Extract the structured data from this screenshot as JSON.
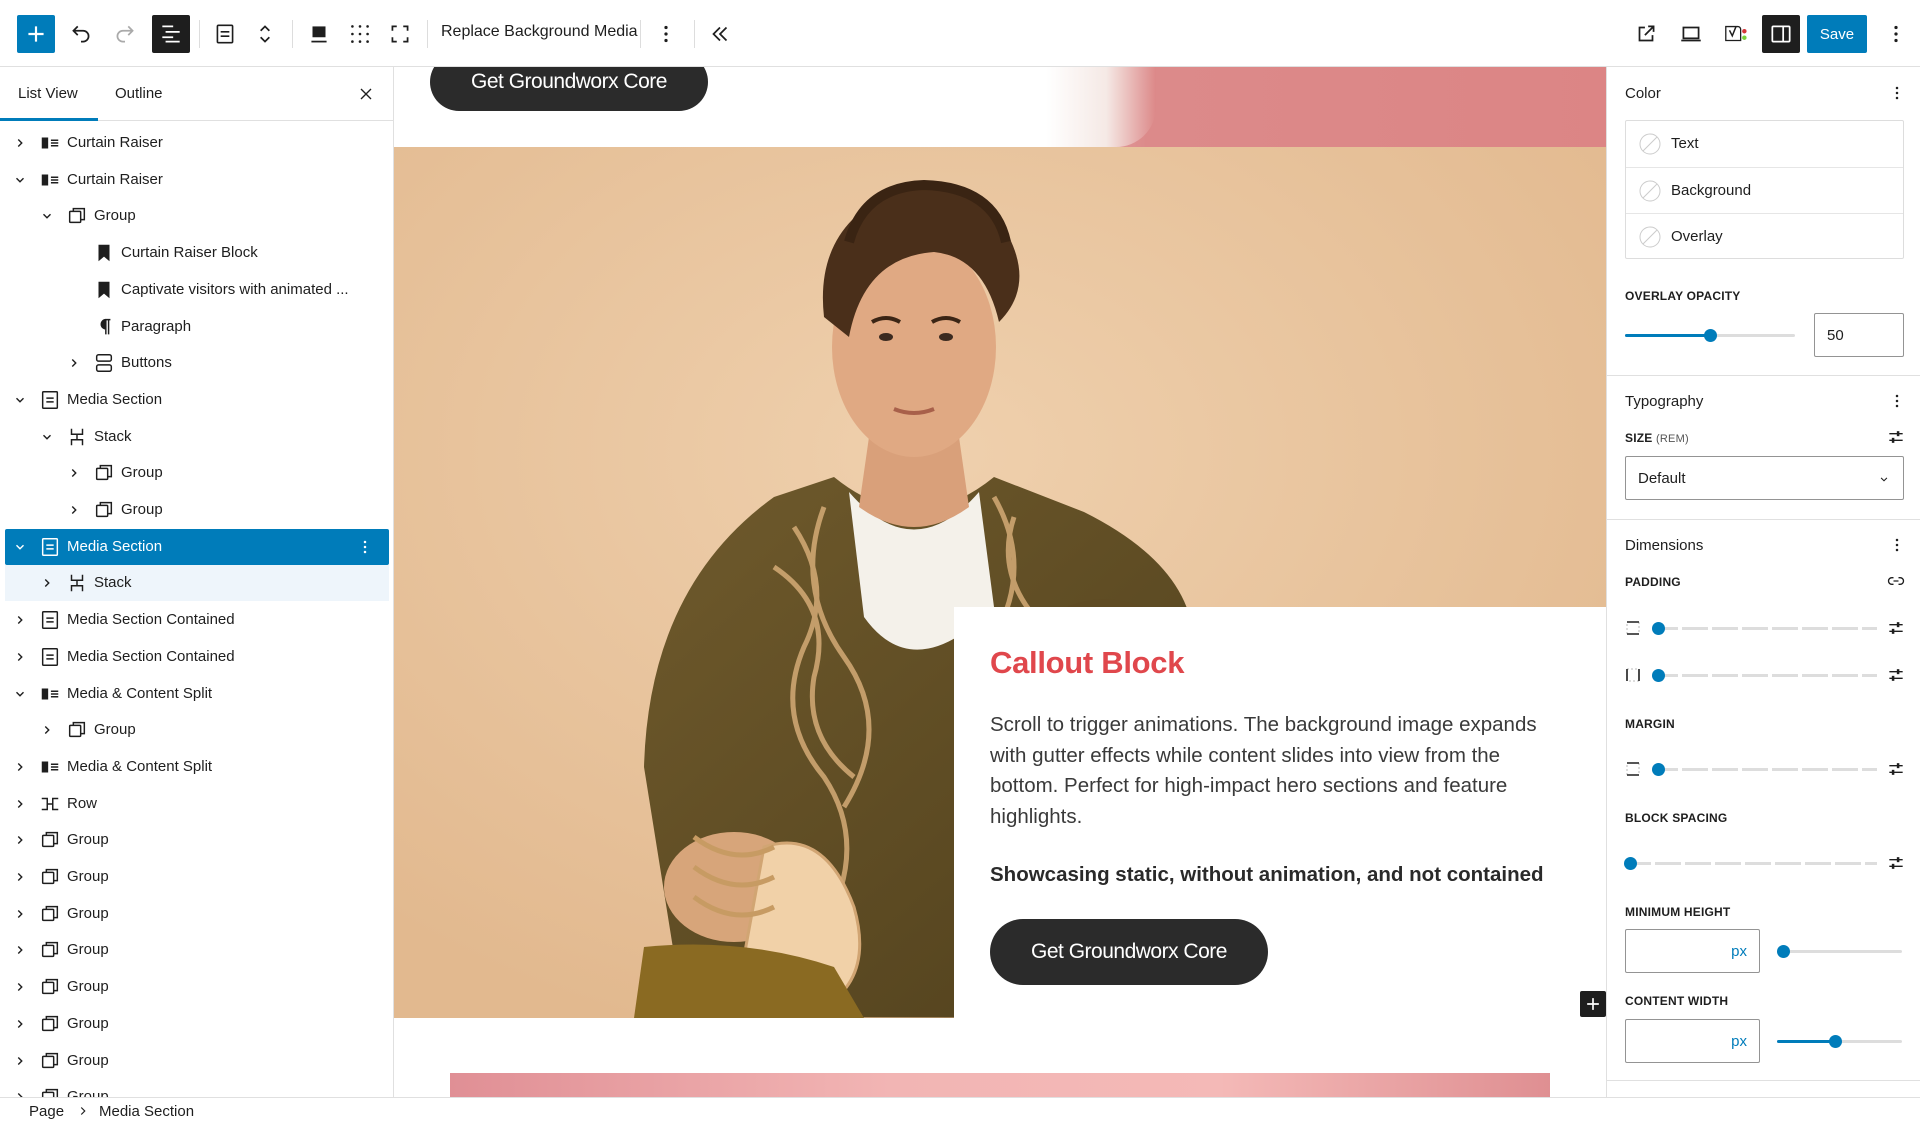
{
  "toolbar": {
    "block_title": "Replace Background Media",
    "save_label": "Save"
  },
  "list_view": {
    "tabs": [
      "List View",
      "Outline"
    ],
    "rows": [
      {
        "label": "Curtain Raiser",
        "icon": "media-text-icon",
        "indent": 0,
        "chevron": "right"
      },
      {
        "label": "Curtain Raiser",
        "icon": "media-text-icon",
        "indent": 0,
        "chevron": "down"
      },
      {
        "label": "Group",
        "icon": "group-icon",
        "indent": 1,
        "chevron": "down"
      },
      {
        "label": "Curtain Raiser Block",
        "icon": "bookmark-icon",
        "indent": 2,
        "chevron": "none"
      },
      {
        "label": "Captivate visitors with animated ...",
        "icon": "bookmark-icon",
        "indent": 2,
        "chevron": "none"
      },
      {
        "label": "Paragraph",
        "icon": "paragraph-icon",
        "indent": 2,
        "chevron": "none"
      },
      {
        "label": "Buttons",
        "icon": "buttons-icon",
        "indent": 2,
        "chevron": "right"
      },
      {
        "label": "Media Section",
        "icon": "section-icon",
        "indent": 0,
        "chevron": "down"
      },
      {
        "label": "Stack",
        "icon": "stack-icon",
        "indent": 1,
        "chevron": "down"
      },
      {
        "label": "Group",
        "icon": "group-icon",
        "indent": 2,
        "chevron": "right"
      },
      {
        "label": "Group",
        "icon": "group-icon",
        "indent": 2,
        "chevron": "right"
      },
      {
        "label": "Media Section",
        "icon": "section-icon",
        "indent": 0,
        "chevron": "down",
        "selected": true
      },
      {
        "label": "Stack",
        "icon": "stack-icon",
        "indent": 1,
        "chevron": "right",
        "child_selected": true
      },
      {
        "label": "Media Section Contained",
        "icon": "section-icon",
        "indent": 0,
        "chevron": "right"
      },
      {
        "label": "Media Section Contained",
        "icon": "section-icon",
        "indent": 0,
        "chevron": "right"
      },
      {
        "label": "Media & Content Split",
        "icon": "media-text-icon",
        "indent": 0,
        "chevron": "down"
      },
      {
        "label": "Group",
        "icon": "group-icon",
        "indent": 1,
        "chevron": "right"
      },
      {
        "label": "Media & Content Split",
        "icon": "media-text-icon",
        "indent": 0,
        "chevron": "right"
      },
      {
        "label": "Row",
        "icon": "row-icon",
        "indent": 0,
        "chevron": "right"
      },
      {
        "label": "Group",
        "icon": "group-icon",
        "indent": 0,
        "chevron": "right"
      },
      {
        "label": "Group",
        "icon": "group-icon",
        "indent": 0,
        "chevron": "right"
      },
      {
        "label": "Group",
        "icon": "group-icon",
        "indent": 0,
        "chevron": "right"
      },
      {
        "label": "Group",
        "icon": "group-icon",
        "indent": 0,
        "chevron": "right"
      },
      {
        "label": "Group",
        "icon": "group-icon",
        "indent": 0,
        "chevron": "right"
      },
      {
        "label": "Group",
        "icon": "group-icon",
        "indent": 0,
        "chevron": "right"
      },
      {
        "label": "Group",
        "icon": "group-icon",
        "indent": 0,
        "chevron": "right"
      },
      {
        "label": "Group",
        "icon": "group-icon",
        "indent": 0,
        "chevron": "right"
      }
    ]
  },
  "breadcrumb": {
    "page": "Page",
    "current": "Media Section"
  },
  "canvas": {
    "top_button": "Get Groundworx Core",
    "callout": {
      "title": "Callout Block",
      "body": "Scroll to trigger animations. The background image expands with gutter effects while content slides into view from the bottom. Perfect for high-impact hero sections and feature highlights.",
      "strong": "Showcasing static, without animation, and not contained",
      "button": "Get Groundworx Core"
    }
  },
  "settings": {
    "color": {
      "title": "Color",
      "items": [
        "Text",
        "Background",
        "Overlay"
      ],
      "overlay_opacity_label": "OVERLAY OPACITY",
      "overlay_opacity_value": "50",
      "overlay_opacity_level": 0.5
    },
    "typography": {
      "title": "Typography",
      "size_label": "SIZE",
      "size_unit": "(REM)",
      "size_value": "Default"
    },
    "dimensions": {
      "title": "Dimensions",
      "padding_label": "PADDING",
      "margin_label": "MARGIN",
      "block_spacing_label": "BLOCK SPACING",
      "min_height_label": "MINIMUM HEIGHT",
      "min_height_unit": "px",
      "content_width_label": "CONTENT WIDTH",
      "content_width_unit": "px"
    }
  },
  "colors": {
    "accent": "#007cba",
    "dark": "#1e1e1e",
    "callout_title": "#e0474c",
    "photo_background": "#e9c29c"
  }
}
